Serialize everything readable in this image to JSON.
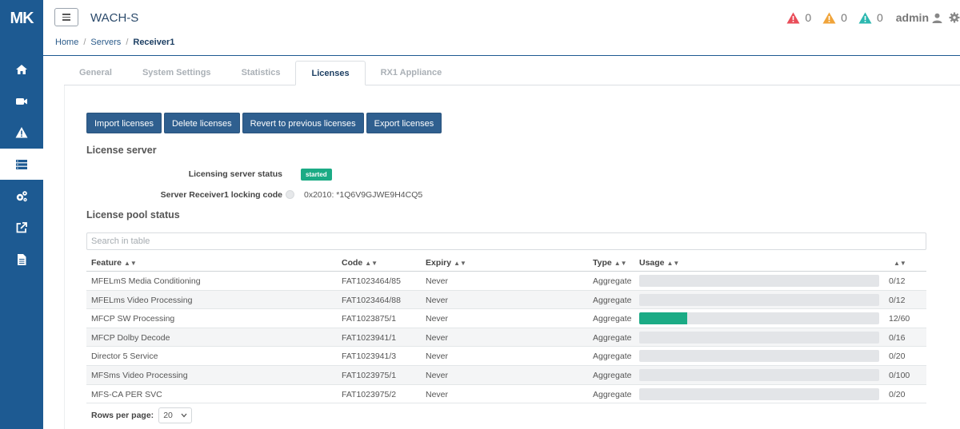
{
  "app": {
    "logo": "MK",
    "title": "WACH-S"
  },
  "breadcrumb": [
    {
      "label": "Home"
    },
    {
      "label": "Servers"
    },
    {
      "label": "Receiver1"
    }
  ],
  "alerts": {
    "red": {
      "count": "0",
      "color": "#e94d59"
    },
    "orange": {
      "count": "0",
      "color": "#f0a43a"
    },
    "teal": {
      "count": "0",
      "color": "#2db8b0"
    }
  },
  "user": {
    "name": "admin"
  },
  "sidebar": {
    "items": [
      {
        "icon": "home-icon"
      },
      {
        "icon": "video-camera-icon"
      },
      {
        "icon": "warning-icon"
      },
      {
        "icon": "server-icon",
        "active": true
      },
      {
        "icon": "gears-icon"
      },
      {
        "icon": "external-link-icon"
      },
      {
        "icon": "document-icon"
      }
    ]
  },
  "tabs": [
    {
      "label": "General"
    },
    {
      "label": "System Settings"
    },
    {
      "label": "Statistics"
    },
    {
      "label": "Licenses",
      "active": true
    },
    {
      "label": "RX1 Appliance"
    }
  ],
  "buttons": {
    "import": "Import licenses",
    "delete": "Delete licenses",
    "revert": "Revert to previous licenses",
    "export": "Export licenses"
  },
  "license_server": {
    "title": "License server",
    "status_label": "Licensing server status",
    "status_value": "started",
    "locking_label": "Server Receiver1 locking code",
    "locking_value": "0x2010: *1Q6V9GJWE9H4CQ5"
  },
  "pool": {
    "title": "License pool status",
    "search_placeholder": "Search in table",
    "columns": {
      "feature": "Feature",
      "code": "Code",
      "expiry": "Expiry",
      "type": "Type",
      "usage": "Usage"
    },
    "rows": [
      {
        "feature": "MFELmS Media Conditioning",
        "code": "FAT1023464/85",
        "expiry": "Never",
        "type": "Aggregate",
        "usage_text": "0/12",
        "usage_fraction": 0
      },
      {
        "feature": "MFELms Video Processing",
        "code": "FAT1023464/88",
        "expiry": "Never",
        "type": "Aggregate",
        "usage_text": "0/12",
        "usage_fraction": 0
      },
      {
        "feature": "MFCP SW Processing",
        "code": "FAT1023875/1",
        "expiry": "Never",
        "type": "Aggregate",
        "usage_text": "12/60",
        "usage_fraction": 0.2
      },
      {
        "feature": "MFCP Dolby Decode",
        "code": "FAT1023941/1",
        "expiry": "Never",
        "type": "Aggregate",
        "usage_text": "0/16",
        "usage_fraction": 0
      },
      {
        "feature": "Director 5 Service",
        "code": "FAT1023941/3",
        "expiry": "Never",
        "type": "Aggregate",
        "usage_text": "0/20",
        "usage_fraction": 0
      },
      {
        "feature": "MFSms Video Processing",
        "code": "FAT1023975/1",
        "expiry": "Never",
        "type": "Aggregate",
        "usage_text": "0/100",
        "usage_fraction": 0
      },
      {
        "feature": "MFS-CA PER SVC",
        "code": "FAT1023975/2",
        "expiry": "Never",
        "type": "Aggregate",
        "usage_text": "0/20",
        "usage_fraction": 0
      }
    ],
    "rows_per_page_label": "Rows per page:",
    "rows_per_page_value": "20"
  },
  "colors": {
    "sidebar": "#1d5a92",
    "button": "#2f5f8f",
    "success": "#1bab85"
  }
}
